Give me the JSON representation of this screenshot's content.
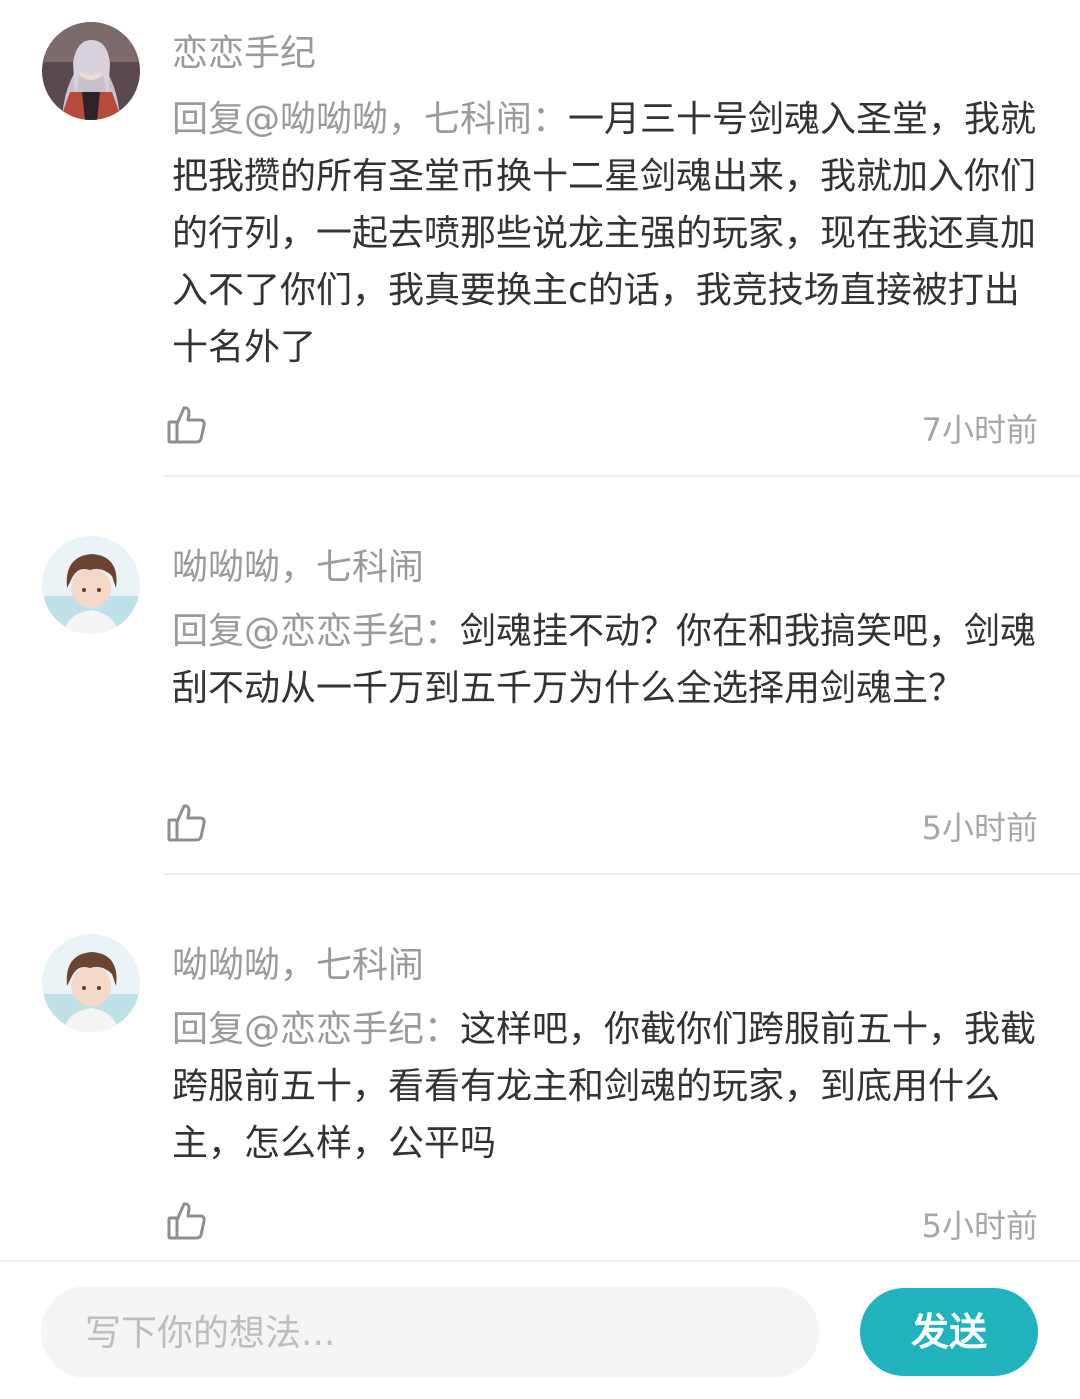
{
  "comments": [
    {
      "username": "恋恋手纪",
      "reply_prefix": "回复@呦呦呦，七科闹：",
      "text": "一月三十号剑魂入圣堂，我就把我攒的所有圣堂币换十二星剑魂出来，我就加入你们的行列，一起去喷那些说龙主强的玩家，现在我还真加入不了你们，我真要换主c的话，我竞技场直接被打出十名外了",
      "time": "7小时前"
    },
    {
      "username": "呦呦呦，七科闹",
      "reply_prefix": "回复@恋恋手纪：",
      "text": "剑魂挂不动？你在和我搞笑吧，剑魂刮不动从一千万到五千万为什么全选择用剑魂主？",
      "time": "5小时前"
    },
    {
      "username": "呦呦呦，七科闹",
      "reply_prefix": "回复@恋恋手纪：",
      "text": "这样吧，你截你们跨服前五十，我截跨服前五十，看看有龙主和剑魂的玩家，到底用什么主，怎么样，公平吗",
      "time": "5小时前"
    }
  ],
  "input": {
    "placeholder": "写下你的想法..."
  },
  "send_label": "发送",
  "colors": {
    "accent": "#20b3be",
    "text": "#333333",
    "muted": "#9a9a9a"
  }
}
